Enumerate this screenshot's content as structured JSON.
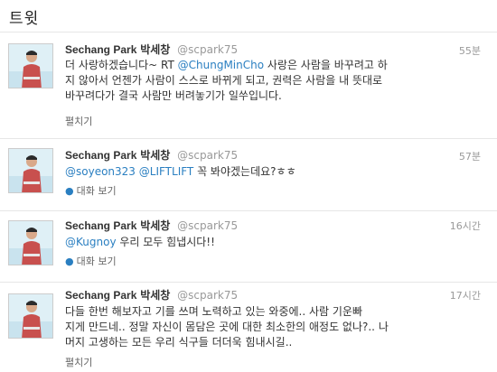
{
  "header": {
    "title": "트윗"
  },
  "author": {
    "name": "Sechang Park",
    "name_kr": "박세창",
    "handle": "@scpark75"
  },
  "tweets": [
    {
      "time": "55분",
      "text_pre": "더 사랑하겠습니다~ RT ",
      "mention": "@ChungMinCho",
      "text_line1_post": " 사랑은 사람을 바꾸려고 하",
      "text_line2": "지 않아서 언젠가 사람이 스스로 바뀌게 되고, 권력은 사람을 내 뜻대로",
      "text_line3": "바꾸려다가 결국 사람만 버려놓기가 일쑤입니다.",
      "action": "펼치기"
    },
    {
      "time": "57분",
      "mention1": "@soyeon323",
      "mention2": "@LIFTLIFT",
      "text_post": " 꼭 봐야겠는데요?ㅎㅎ",
      "action": "대화 보기"
    },
    {
      "time": "16시간",
      "mention": "@Kugnoy",
      "text_post": " 우리 모두 힘냅시다!!",
      "action": "대화 보기"
    },
    {
      "time": "17시간",
      "text_line1": "다들 한번 해보자고 기를 쓰며 노력하고 있는 와중에.. 사람 기운빠",
      "text_line2": "지게 만드네.. 정말 자신이 몸담은 곳에 대한 최소한의 애정도 없나?.. 나",
      "text_line3": "머지 고생하는 모든 우리 식구들 더더욱 힘내시길..",
      "action": "펼치기"
    }
  ]
}
